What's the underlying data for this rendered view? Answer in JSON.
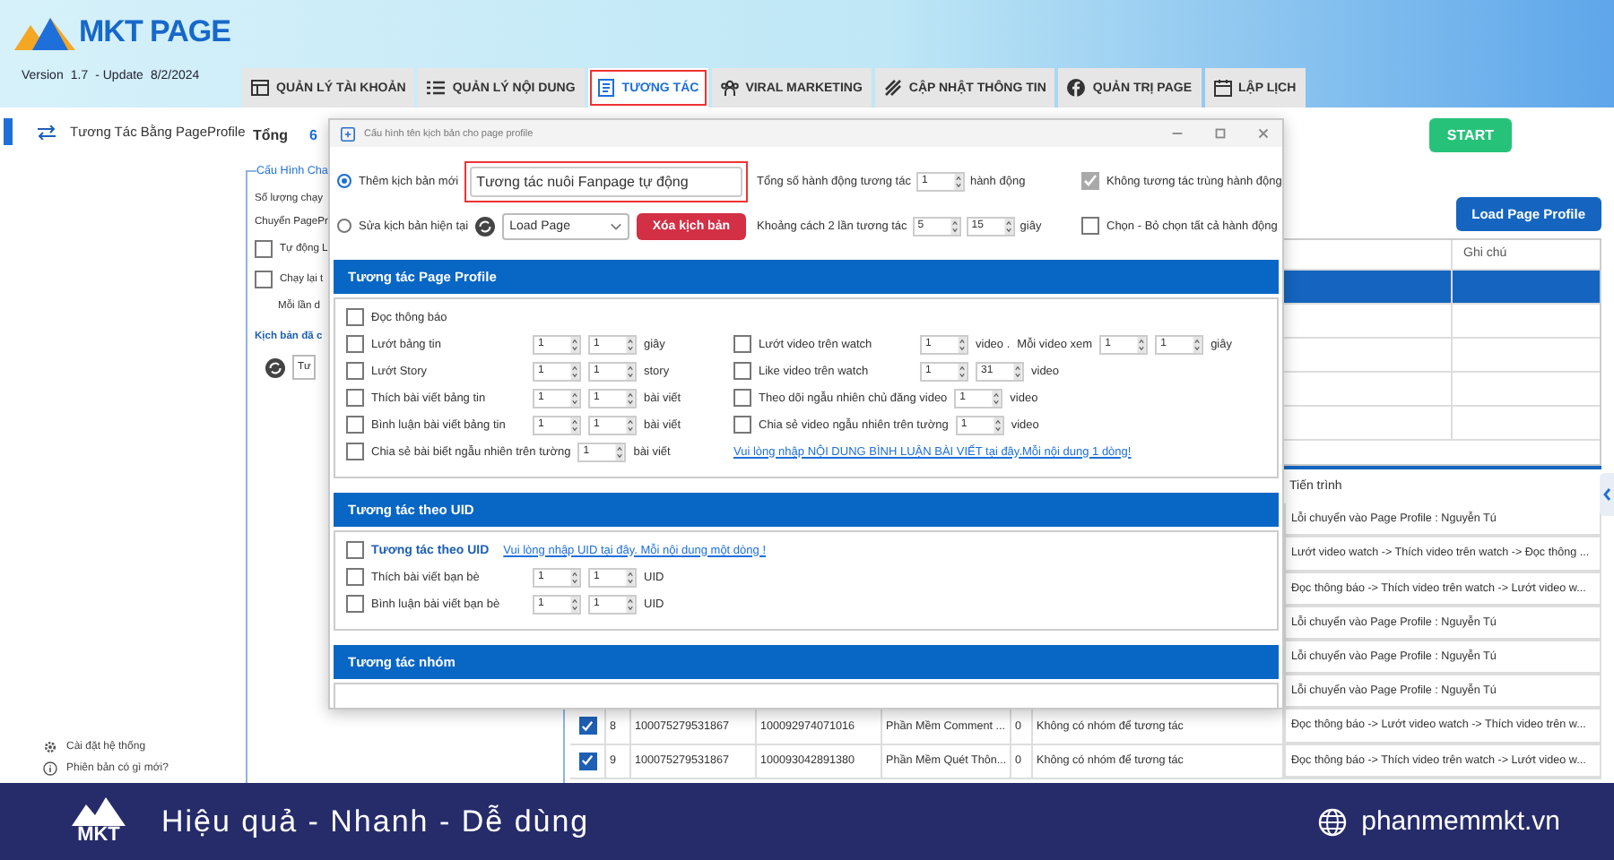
{
  "app": {
    "logo": "MKT PAGE",
    "version_label": "Version",
    "version": "1.7",
    "update_label": "- Update",
    "update_date": "8/2/2024"
  },
  "tabs": [
    {
      "label": "QUẢN LÝ TÀI KHOẢN",
      "selected": false
    },
    {
      "label": "QUẢN LÝ NỘI DUNG",
      "selected": false
    },
    {
      "label": "TƯƠNG TÁC",
      "selected": true
    },
    {
      "label": "VIRAL MARKETING",
      "selected": false
    },
    {
      "label": "CẬP NHẬT THÔNG TIN",
      "selected": false
    },
    {
      "label": "QUẢN TRỊ PAGE",
      "selected": false
    },
    {
      "label": "LẬP LỊCH",
      "selected": false
    }
  ],
  "sidebar": {
    "items": [
      {
        "label": "Tương Tác Bằng PageProfile",
        "selected": true
      }
    ],
    "footer_links": [
      "Cài đặt hệ thống",
      "Phiên bản có gì mới?"
    ]
  },
  "main": {
    "total_label": "Tổng",
    "total": "6",
    "start_button": "START",
    "config_panel": {
      "title": "Cấu Hình Cha",
      "lines": [
        {
          "kind": "text",
          "text": "Số lượng chạy"
        },
        {
          "kind": "text",
          "text": "Chuyển PagePr"
        },
        {
          "kind": "checkbox",
          "text": "Tự động L",
          "checked": false
        },
        {
          "kind": "checkbox",
          "text": "Chạy lại t",
          "checked": false
        },
        {
          "kind": "indent",
          "text": "Mỗi lần d"
        },
        {
          "kind": "heading",
          "text": "Kịch bản đã c"
        },
        {
          "kind": "select",
          "text": "Tư"
        }
      ]
    },
    "load_button": "Load Page Profile",
    "top_table": {
      "columns": [
        "Ghi chú"
      ],
      "rows": [
        {
          "selected": true
        },
        {
          "selected": false
        },
        {
          "selected": false
        },
        {
          "selected": false
        },
        {
          "selected": false
        }
      ]
    },
    "log_table": {
      "columns": [
        "Tiến trình"
      ],
      "rows": [
        {
          "progress": "Lỗi chuyển vào Page Profile : Nguyễn Tú"
        },
        {
          "progress": "Lướt video watch -> Thích video trên watch -> Đọc thông ..."
        },
        {
          "progress": "Đọc thông báo -> Thích video trên watch -> Lướt video w..."
        },
        {
          "progress": "Lỗi chuyển vào Page Profile : Nguyễn Tú"
        },
        {
          "progress": "Lỗi chuyển vào Page Profile : Nguyễn Tú"
        },
        {
          "progress": "Lỗi chuyển vào Page Profile : Nguyễn Tú"
        },
        {
          "checked": true,
          "index": "8",
          "uid": "100075279531867",
          "target_uid": "100092974071016",
          "name": "Phần Mềm Comment ...",
          "count": "0",
          "note": "Không có nhóm để tương tác",
          "progress": "Đọc thông báo -> Lướt video watch -> Thích video trên w..."
        },
        {
          "checked": true,
          "index": "9",
          "uid": "100075279531867",
          "target_uid": "100093042891380",
          "name": "Phần Mềm Quét Thôn...",
          "count": "0",
          "note": "Không có nhóm để tương tác",
          "progress": "Đọc thông báo -> Thích video trên watch -> Lướt video w..."
        }
      ]
    }
  },
  "dialog": {
    "title": "Cấu hình tên kịch bản cho page profile",
    "new_script": {
      "label": "Thêm kịch bản mới",
      "selected": true,
      "value": "Tương tác nuôi Fanpage tự động",
      "highlighted": true
    },
    "edit_script": {
      "label": "Sửa kịch bản hiện tại",
      "selected": false,
      "select_value": "Load Page"
    },
    "delete_button": "Xóa kịch bản",
    "total_actions": {
      "label": "Tổng số hành động tương tác",
      "value": "1",
      "unit": "hành động"
    },
    "interval": {
      "label": "Khoảng cách 2 lần tương tác",
      "min": "5",
      "max": "15",
      "unit": "giây"
    },
    "no_repeat": {
      "label": "Không tương tác trùng hành động",
      "checked": true
    },
    "select_all": {
      "label": "Chọn - Bỏ chọn tất cả hành động",
      "checked": false
    },
    "sections": [
      {
        "title": "Tương tác Page Profile",
        "rows": [
          [
            {
              "kind": "option",
              "label": "Đọc thông báo",
              "checked": false
            }
          ],
          [
            {
              "kind": "option",
              "label": "Lướt bảng tin",
              "checked": false,
              "parts": [
                {
                  "kind": "spin",
                  "value": "1"
                },
                {
                  "kind": "spin",
                  "value": "1"
                },
                {
                  "kind": "text",
                  "text": "giây"
                }
              ]
            },
            {
              "kind": "option",
              "label": "Lướt video trên watch",
              "checked": false,
              "parts": [
                {
                  "kind": "spin",
                  "value": "1"
                },
                {
                  "kind": "text",
                  "text": "video ."
                },
                {
                  "kind": "text",
                  "text": "Mỗi video xem"
                },
                {
                  "kind": "spin",
                  "value": "1"
                },
                {
                  "kind": "spin",
                  "value": "1"
                },
                {
                  "kind": "text",
                  "text": "giây"
                }
              ]
            }
          ],
          [
            {
              "kind": "option",
              "label": "Lướt Story",
              "checked": false,
              "parts": [
                {
                  "kind": "spin",
                  "value": "1"
                },
                {
                  "kind": "spin",
                  "value": "1"
                },
                {
                  "kind": "text",
                  "text": "story"
                }
              ]
            },
            {
              "kind": "option",
              "label": "Like video trên watch",
              "checked": false,
              "parts": [
                {
                  "kind": "spin",
                  "value": "1"
                },
                {
                  "kind": "spin",
                  "value": "31"
                },
                {
                  "kind": "text",
                  "text": "video"
                }
              ]
            }
          ],
          [
            {
              "kind": "option",
              "label": "Thích bài viết bảng tin",
              "checked": false,
              "parts": [
                {
                  "kind": "spin",
                  "value": "1"
                },
                {
                  "kind": "spin",
                  "value": "1"
                },
                {
                  "kind": "text",
                  "text": "bài viết"
                }
              ]
            },
            {
              "kind": "option",
              "label": "Theo dõi ngẫu nhiên chủ đăng video",
              "checked": false,
              "parts": [
                {
                  "kind": "spin",
                  "value": "1"
                },
                {
                  "kind": "text",
                  "text": "video"
                }
              ]
            }
          ],
          [
            {
              "kind": "option",
              "label": "Bình luận bài viết bảng tin",
              "checked": false,
              "parts": [
                {
                  "kind": "spin",
                  "value": "1"
                },
                {
                  "kind": "spin",
                  "value": "1"
                },
                {
                  "kind": "text",
                  "text": "bài viết"
                }
              ]
            },
            {
              "kind": "option",
              "label": "Chia sẻ video ngẫu nhiên trên tường",
              "checked": false,
              "parts": [
                {
                  "kind": "spin",
                  "value": "1"
                },
                {
                  "kind": "text",
                  "text": "video"
                }
              ]
            }
          ],
          [
            {
              "kind": "option",
              "label": "Chia sẻ bài biết ngẫu nhiên trên tường",
              "checked": false,
              "parts": [
                {
                  "kind": "spin",
                  "value": "1"
                },
                {
                  "kind": "text",
                  "text": "bài viết"
                }
              ]
            },
            {
              "kind": "link",
              "label": "Vui lòng nhập NỘI DUNG BÌNH LUẬN BÀI VIẾT tại đây.Mỗi nội dung 1 dòng!"
            }
          ]
        ]
      },
      {
        "title": "Tương tác theo UID",
        "rows": [
          [
            {
              "kind": "primary",
              "label": "Tương tác theo UID",
              "checked": false
            },
            {
              "kind": "link",
              "label": "Vui lòng nhập UID tại đây. Mỗi nội dung một dòng !"
            }
          ],
          [
            {
              "kind": "option",
              "label": "Thích bài viết bạn bè",
              "checked": false,
              "parts": [
                {
                  "kind": "spin",
                  "value": "1"
                },
                {
                  "kind": "spin",
                  "value": "1"
                },
                {
                  "kind": "text",
                  "text": "UID"
                }
              ]
            }
          ],
          [
            {
              "kind": "option",
              "label": "Bình luận bài viết bạn bè",
              "checked": false,
              "parts": [
                {
                  "kind": "spin",
                  "value": "1"
                },
                {
                  "kind": "spin",
                  "value": "1"
                },
                {
                  "kind": "text",
                  "text": "UID"
                }
              ]
            }
          ]
        ]
      },
      {
        "title": "Tương tác nhóm"
      }
    ]
  },
  "banner": {
    "logo_text": "MKT",
    "slogan": "Hiệu quả - Nhanh - Dễ dùng",
    "website": "phanmemmkt.vn"
  }
}
